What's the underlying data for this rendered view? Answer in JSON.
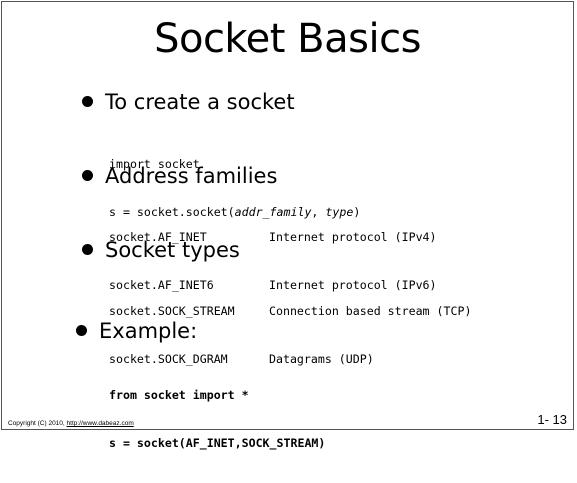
{
  "title": "Socket Basics",
  "sections": [
    {
      "heading": "To create a socket",
      "lines": [
        {
          "text": "import socket"
        },
        {
          "prefix": "s = socket.socket(",
          "arg1": "addr_family",
          "sep": ", ",
          "arg2": "type",
          "suffix": ")"
        }
      ]
    },
    {
      "heading": "Address families",
      "rows": [
        {
          "name": "socket.AF_INET",
          "desc": "Internet protocol (IPv4)"
        },
        {
          "name": "socket.AF_INET6",
          "desc": "Internet protocol (IPv6)"
        }
      ]
    },
    {
      "heading": "Socket types",
      "rows": [
        {
          "name": "socket.SOCK_STREAM",
          "desc": "Connection based stream (TCP)"
        },
        {
          "name": "socket.SOCK_DGRAM",
          "desc": "Datagrams (UDP)"
        }
      ]
    },
    {
      "heading": "Example:",
      "lines": [
        {
          "text": "from socket import *"
        },
        {
          "text": "s = socket(AF_INET,SOCK_STREAM)"
        }
      ]
    }
  ],
  "footer": {
    "copyright": "Copyright (C) 2010, ",
    "link": "http://www.dabeaz.com"
  },
  "page_number": "1- 13"
}
